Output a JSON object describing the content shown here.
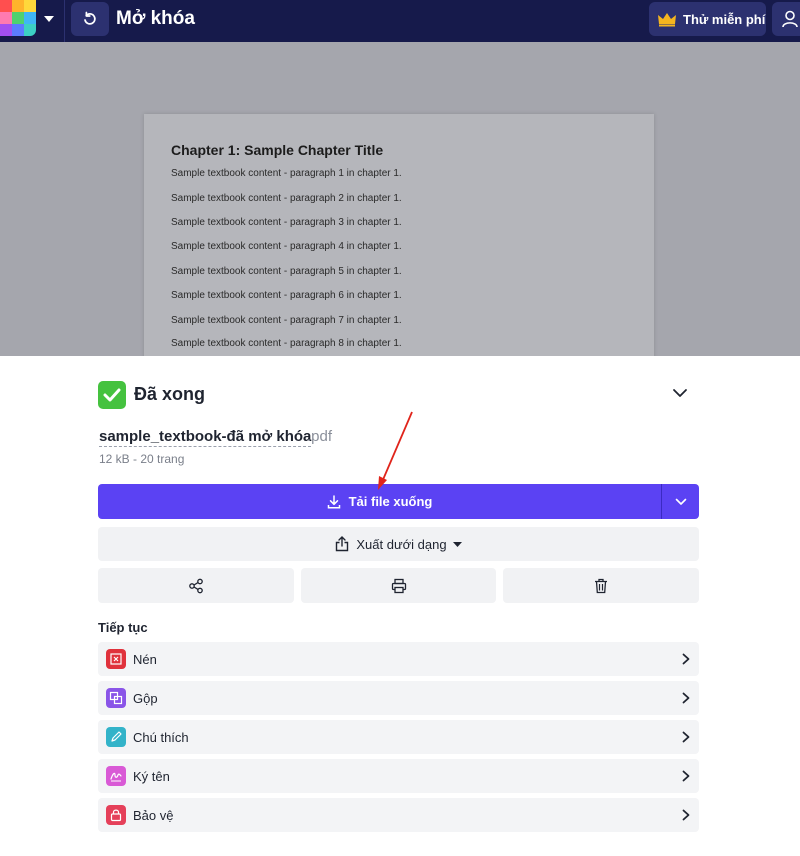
{
  "topbar": {
    "title": "Mở khóa",
    "trial_label": "Thử miễn phí"
  },
  "preview": {
    "doc_title": "Chapter 1: Sample Chapter Title",
    "lines": [
      "Sample textbook content - paragraph 1 in chapter 1.",
      "Sample textbook content - paragraph 2 in chapter 1.",
      "Sample textbook content - paragraph 3 in chapter 1.",
      "Sample textbook content - paragraph 4 in chapter 1.",
      "Sample textbook content - paragraph 5 in chapter 1.",
      "Sample textbook content - paragraph 6 in chapter 1.",
      "Sample textbook content - paragraph 7 in chapter 1.",
      "Sample textbook content - paragraph 8 in chapter 1."
    ]
  },
  "result": {
    "status": "Đã xong",
    "file_name": "sample_textbook-đã mở khóa",
    "file_ext": ".pdf",
    "file_meta": "12 kB - 20 trang",
    "download_label": "Tải file xuống",
    "export_label": "Xuất dưới dạng"
  },
  "actions": [
    {
      "icon": "share-icon"
    },
    {
      "icon": "print-icon"
    },
    {
      "icon": "trash-icon"
    }
  ],
  "continue": {
    "label": "Tiếp tục",
    "tools": [
      {
        "label": "Nén",
        "icon": "compress-icon",
        "color": "#e0323c"
      },
      {
        "label": "Gộp",
        "icon": "merge-icon",
        "color": "#8a55e8"
      },
      {
        "label": "Chú thích",
        "icon": "annotate-pen-icon",
        "color": "#33b3c9"
      },
      {
        "label": "Ký tên",
        "icon": "signature-icon",
        "color": "#d95ad6"
      },
      {
        "label": "Bảo vệ",
        "icon": "lock-icon",
        "color": "#e5405a"
      }
    ]
  },
  "colors": {
    "topbar": "#161a4b",
    "accent": "#5b42f3",
    "success": "#45c23f",
    "annotation_arrow": "#e0241b"
  }
}
